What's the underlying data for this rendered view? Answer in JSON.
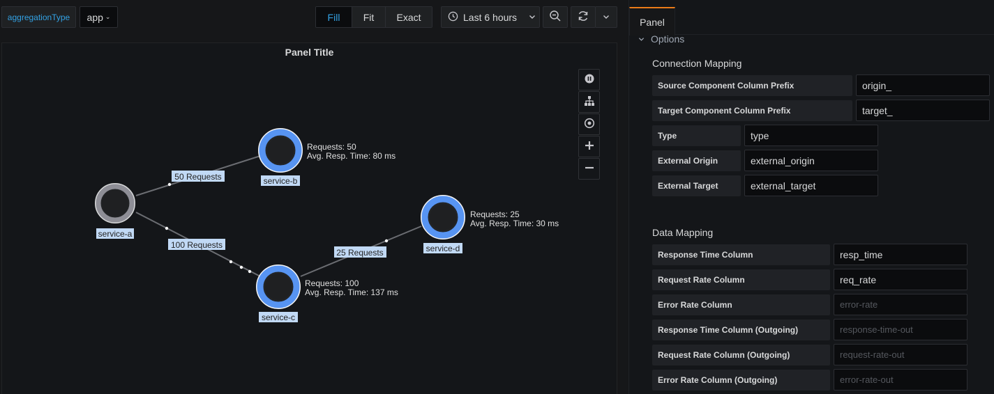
{
  "toolbar": {
    "variable_label": "aggregationType",
    "variable_value": "app",
    "view_modes": [
      {
        "label": "Fill",
        "active": true
      },
      {
        "label": "Fit",
        "active": false
      },
      {
        "label": "Exact",
        "active": false
      }
    ],
    "time_range": "Last 6 hours"
  },
  "panel": {
    "title": "Panel Title",
    "graph": {
      "nodes": [
        {
          "id": "service-a",
          "label": "service-a",
          "requests": "",
          "resp_time": ""
        },
        {
          "id": "service-b",
          "label": "service-b",
          "requests": "Requests: 50",
          "resp_time": "Avg. Resp. Time: 80 ms"
        },
        {
          "id": "service-c",
          "label": "service-c",
          "requests": "Requests: 100",
          "resp_time": "Avg. Resp. Time: 137 ms"
        },
        {
          "id": "service-d",
          "label": "service-d",
          "requests": "Requests: 25",
          "resp_time": "Avg. Resp. Time: 30 ms"
        }
      ],
      "edges": [
        {
          "from": "service-a",
          "to": "service-b",
          "label": "50 Requests"
        },
        {
          "from": "service-a",
          "to": "service-c",
          "label": "100 Requests"
        },
        {
          "from": "service-c",
          "to": "service-d",
          "label": "25 Requests"
        }
      ]
    },
    "controls": [
      "pause-icon",
      "layout-icon",
      "center-icon",
      "zoom-in-icon",
      "zoom-out-icon"
    ]
  },
  "editor": {
    "tab": "Panel",
    "options_label": "Options",
    "connection_mapping": {
      "title": "Connection Mapping",
      "fields": [
        {
          "label": "Source Component Column Prefix",
          "value": "origin_",
          "placeholder": ""
        },
        {
          "label": "Target Component Column Prefix",
          "value": "target_",
          "placeholder": ""
        },
        {
          "label": "Type",
          "value": "type",
          "placeholder": ""
        },
        {
          "label": "External Origin",
          "value": "external_origin",
          "placeholder": ""
        },
        {
          "label": "External Target",
          "value": "external_target",
          "placeholder": ""
        }
      ]
    },
    "data_mapping": {
      "title": "Data Mapping",
      "fields": [
        {
          "label": "Response Time Column",
          "value": "resp_time",
          "placeholder": ""
        },
        {
          "label": "Request Rate Column",
          "value": "req_rate",
          "placeholder": ""
        },
        {
          "label": "Error Rate Column",
          "value": "",
          "placeholder": "error-rate"
        },
        {
          "label": "Response Time Column (Outgoing)",
          "value": "",
          "placeholder": "response-time-out"
        },
        {
          "label": "Request Rate Column (Outgoing)",
          "value": "",
          "placeholder": "request-rate-out"
        },
        {
          "label": "Error Rate Column (Outgoing)",
          "value": "",
          "placeholder": "error-rate-out"
        }
      ]
    }
  },
  "colors": {
    "accent_blue": "#33a2e5",
    "node_ring": "#5794f2",
    "node_ring_external": "#8e8e96",
    "tab_accent": "#eb7b18"
  }
}
